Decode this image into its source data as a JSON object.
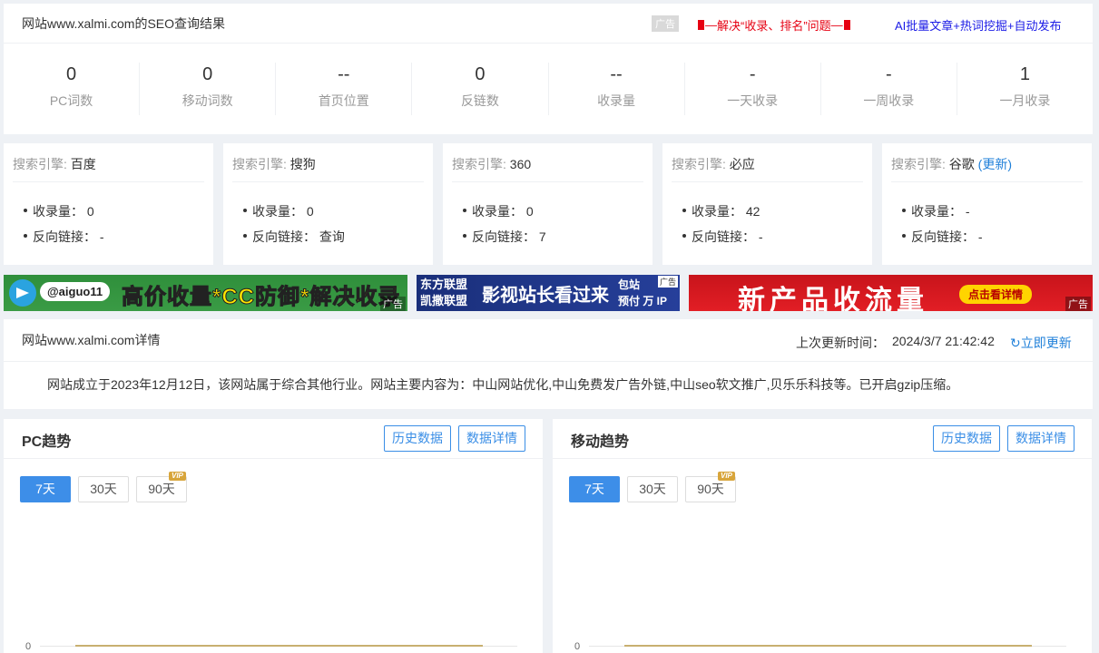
{
  "summary": {
    "title": "网站www.xalmi.com的SEO查询结果",
    "ad_tag": "广告",
    "ad_red": "解决“收录、排名”问题",
    "ad_blue": "AI批量文章+热词挖掘+自动发布",
    "stats": [
      {
        "value": "0",
        "label": "PC词数"
      },
      {
        "value": "0",
        "label": "移动词数"
      },
      {
        "value": "--",
        "label": "首页位置"
      },
      {
        "value": "0",
        "label": "反链数"
      },
      {
        "value": "--",
        "label": "收录量"
      },
      {
        "value": "-",
        "label": "一天收录"
      },
      {
        "value": "-",
        "label": "一周收录"
      },
      {
        "value": "1",
        "label": "一月收录"
      }
    ]
  },
  "engines": {
    "key_label": "搜索引擎:",
    "indexed_label": "收录量：",
    "backlink_label": "反向链接：",
    "update_label": "(更新)",
    "items": [
      {
        "name": "百度",
        "indexed": "0",
        "backlinks": "-"
      },
      {
        "name": "搜狗",
        "indexed": "0",
        "backlinks": "查询"
      },
      {
        "name": "360",
        "indexed": "0",
        "backlinks": "7"
      },
      {
        "name": "必应",
        "indexed": "42",
        "backlinks": "-"
      },
      {
        "name": "谷歌",
        "indexed": "-",
        "backlinks": "-"
      }
    ]
  },
  "banners": {
    "b1_handle": "@aiguo11",
    "b1_text": "高价收量*CC防御*解决收录",
    "ad_corner": "广告",
    "b2_left_1": "东方联盟",
    "b2_left_2": "凯撒联盟",
    "b2_mid": "影视站长看过来",
    "b2_right_1": "包站",
    "b2_right_2": "预付 万 IP",
    "b2_tag": "广告",
    "b3_text": "新产品收流量",
    "b3_btn": "点击看详情",
    "b3_corner": "广告"
  },
  "detail": {
    "title": "网站www.xalmi.com详情",
    "updated_label": "上次更新时间：",
    "updated_time": "2024/3/7 21:42:42",
    "refresh": "立即更新",
    "description": "网站成立于2023年12月12日，该网站属于综合其他行业。网站主要内容为：中山网站优化,中山免费发广告外链,中山seo软文推广,贝乐乐科技等。已开启gzip压缩。"
  },
  "trends": {
    "history_btn": "历史数据",
    "details_btn": "数据详情",
    "ranges": [
      "7天",
      "30天",
      "90天"
    ],
    "active_range": "7天",
    "vip": "VIP",
    "pc_title": "PC趋势",
    "mobile_title": "移动趋势"
  },
  "chart_data": [
    {
      "type": "line",
      "title": "PC趋势",
      "y_tick_labels": [
        "0"
      ],
      "series": [
        {
          "values": [
            0,
            0,
            0,
            0,
            0,
            0,
            0
          ]
        }
      ],
      "color": "#c8b070"
    },
    {
      "type": "line",
      "title": "移动趋势",
      "y_tick_labels": [
        "0"
      ],
      "series": [
        {
          "values": [
            0,
            0,
            0,
            0,
            0,
            0,
            0
          ]
        }
      ],
      "color": "#c8b070"
    }
  ]
}
